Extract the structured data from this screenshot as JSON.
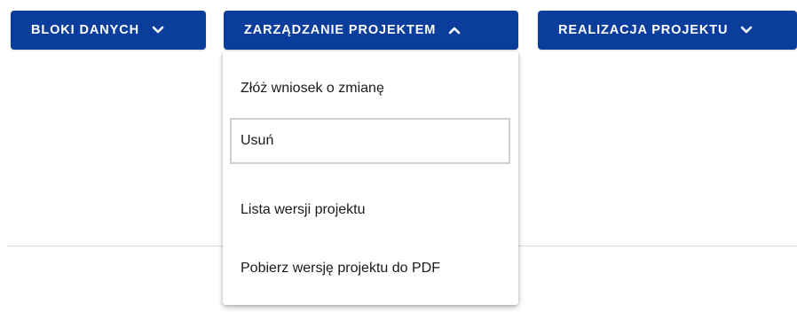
{
  "nav": {
    "buttons": [
      {
        "label": "BLOKI DANYCH",
        "icon": "chevron-down-icon"
      },
      {
        "label": "ZARZĄDZANIE PROJEKTEM",
        "icon": "chevron-up-icon"
      },
      {
        "label": "REALIZACJA PROJEKTU",
        "icon": "chevron-down-icon"
      }
    ]
  },
  "menu": {
    "items": [
      {
        "label": "Złóż wniosek o zmianę"
      },
      {
        "label": "Usuń",
        "focused": true
      },
      {
        "label": "Lista wersji projektu"
      },
      {
        "label": "Pobierz wersję projektu do PDF"
      }
    ]
  },
  "colors": {
    "button_bg": "#0a3d9c",
    "button_text": "#ffffff",
    "menu_text": "#1a1a1a",
    "focus_border": "#cfcfcf"
  }
}
